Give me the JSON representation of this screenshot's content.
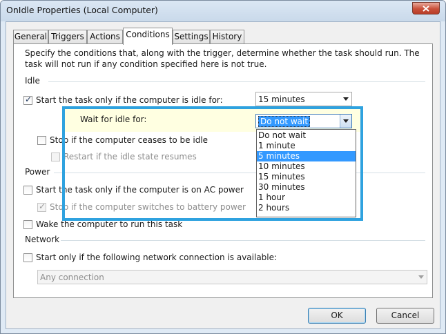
{
  "window": {
    "title": "OnIdle Properties (Local Computer)",
    "close_icon": "close-icon"
  },
  "tabs": [
    {
      "label": "General"
    },
    {
      "label": "Triggers"
    },
    {
      "label": "Actions"
    },
    {
      "label": "Conditions",
      "active": true
    },
    {
      "label": "Settings"
    },
    {
      "label": "History"
    }
  ],
  "conditions": {
    "description": "Specify the conditions that, along with the trigger, determine whether the task should run.  The task will not run  if any condition specified here is not true.",
    "idle": {
      "section_label": "Idle",
      "start_only_idle": {
        "label": "Start the task only if the computer is idle for:",
        "checked": true,
        "value": "15 minutes"
      },
      "wait_for_idle": {
        "label": "Wait for idle for:",
        "value": "Do not wait"
      },
      "stop_if_ceases": {
        "label": "Stop if the computer ceases to be idle",
        "checked": false
      },
      "restart_if_resumes": {
        "label": "Restart if the idle state resumes",
        "checked": false,
        "disabled": true
      },
      "wait_options": [
        "Do not wait",
        "1 minute",
        "5 minutes",
        "10 minutes",
        "15 minutes",
        "30 minutes",
        "1 hour",
        "2 hours"
      ],
      "highlighted_option": "5 minutes"
    },
    "power": {
      "section_label": "Power",
      "ac_power": {
        "label": "Start the task only if the computer is on AC power",
        "checked": false
      },
      "battery_stop": {
        "label": "Stop if the computer switches to battery power",
        "checked": true,
        "disabled": true
      },
      "wake": {
        "label": "Wake the computer to run this task",
        "checked": false
      }
    },
    "network": {
      "section_label": "Network",
      "network_only": {
        "label": "Start only if the following network connection is available:",
        "checked": false
      },
      "connection": {
        "value": "Any connection",
        "disabled": true
      }
    }
  },
  "buttons": {
    "ok": "OK",
    "cancel": "Cancel"
  },
  "colors": {
    "highlight_border": "#2fa2df",
    "highlight_fill": "#ffffe1",
    "selection": "#3399ff"
  }
}
